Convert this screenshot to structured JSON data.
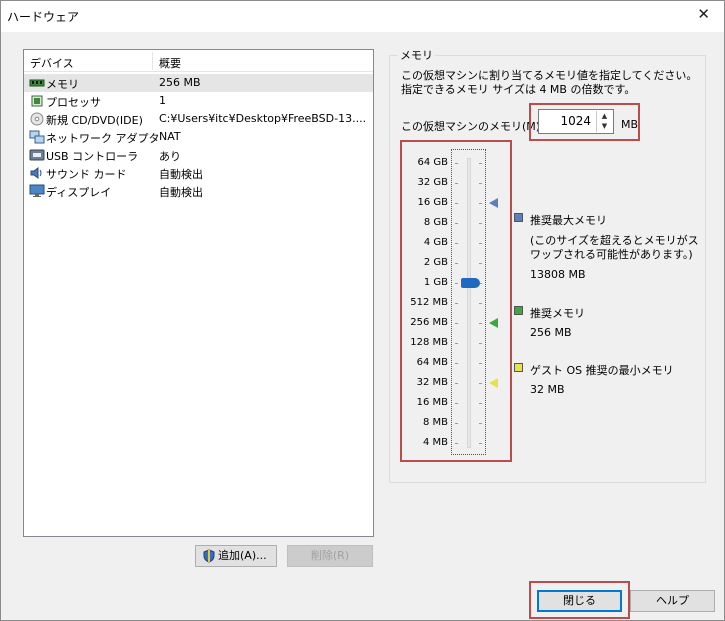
{
  "window": {
    "title": "ハードウェア",
    "close_glyph": "✕"
  },
  "devices": {
    "header": {
      "device": "デバイス",
      "summary": "概要"
    },
    "rows": [
      {
        "name": "メモリ",
        "summary": "256 MB",
        "icon": "memory-icon"
      },
      {
        "name": "プロセッサ",
        "summary": "1",
        "icon": "processor-icon"
      },
      {
        "name": "新規 CD/DVD(IDE)",
        "summary": "C:¥Users¥itc¥Desktop¥FreeBSD-13....",
        "icon": "cd-dvd-icon"
      },
      {
        "name": "ネットワーク アダプタ",
        "summary": "NAT",
        "icon": "network-adapter-icon"
      },
      {
        "name": "USB コントローラ",
        "summary": "あり",
        "icon": "usb-icon"
      },
      {
        "name": "サウンド カード",
        "summary": "自動検出",
        "icon": "sound-card-icon"
      },
      {
        "name": "ディスプレイ",
        "summary": "自動検出",
        "icon": "display-icon"
      }
    ],
    "add_label": "追加(A)...",
    "remove_label": "削除(R)"
  },
  "memory": {
    "group_label": "メモリ",
    "description": "この仮想マシンに割り当てるメモリ値を指定してください。指定できるメモリ サイズは 4 MB の倍数です。",
    "field_label": "この仮想マシンのメモリ(M):",
    "value": "1024",
    "unit": "MB",
    "scale": [
      "64 GB",
      "32 GB",
      "16 GB",
      "8 GB",
      "4 GB",
      "2 GB",
      "1 GB",
      "512 MB",
      "256 MB",
      "128 MB",
      "64 MB",
      "32 MB",
      "16 MB",
      "8 MB",
      "4 MB"
    ],
    "current_scale_label": "1 GB",
    "legend": {
      "max": {
        "title": "推奨最大メモリ",
        "note": "(このサイズを超えるとメモリがスワップされる可能性があります。)",
        "value": "13808 MB",
        "color": "#5b7fbf",
        "marker_at": "16 GB"
      },
      "recommended": {
        "title": "推奨メモリ",
        "value": "256 MB",
        "color": "#3ea83e",
        "marker_at": "256 MB"
      },
      "minimum": {
        "title": "ゲスト OS 推奨の最小メモリ",
        "value": "32 MB",
        "color": "#e8e24a",
        "marker_at": "32 MB"
      }
    }
  },
  "footer": {
    "close_label": "閉じる",
    "help_label": "ヘルプ"
  },
  "highlight_color": "#b94d4d"
}
